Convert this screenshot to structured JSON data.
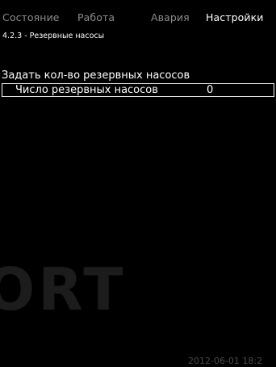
{
  "tabs": [
    {
      "label": "Состояние",
      "active": false
    },
    {
      "label": "Работа",
      "active": false
    },
    {
      "label": "Авария",
      "active": false
    },
    {
      "label": "Настройки",
      "active": true
    }
  ],
  "breadcrumb": "4.2.3 - Резервные насосы",
  "section": {
    "title": "Задать кол-во резервных насосов",
    "setting": {
      "label": "Число резервных насосов",
      "value": "0"
    }
  },
  "watermark": "ORT",
  "datetime": "2012-06-01 18:2",
  "colors": {
    "background": "#000000",
    "text": "#ffffff",
    "inactive_tab": "#8c8c8c"
  }
}
